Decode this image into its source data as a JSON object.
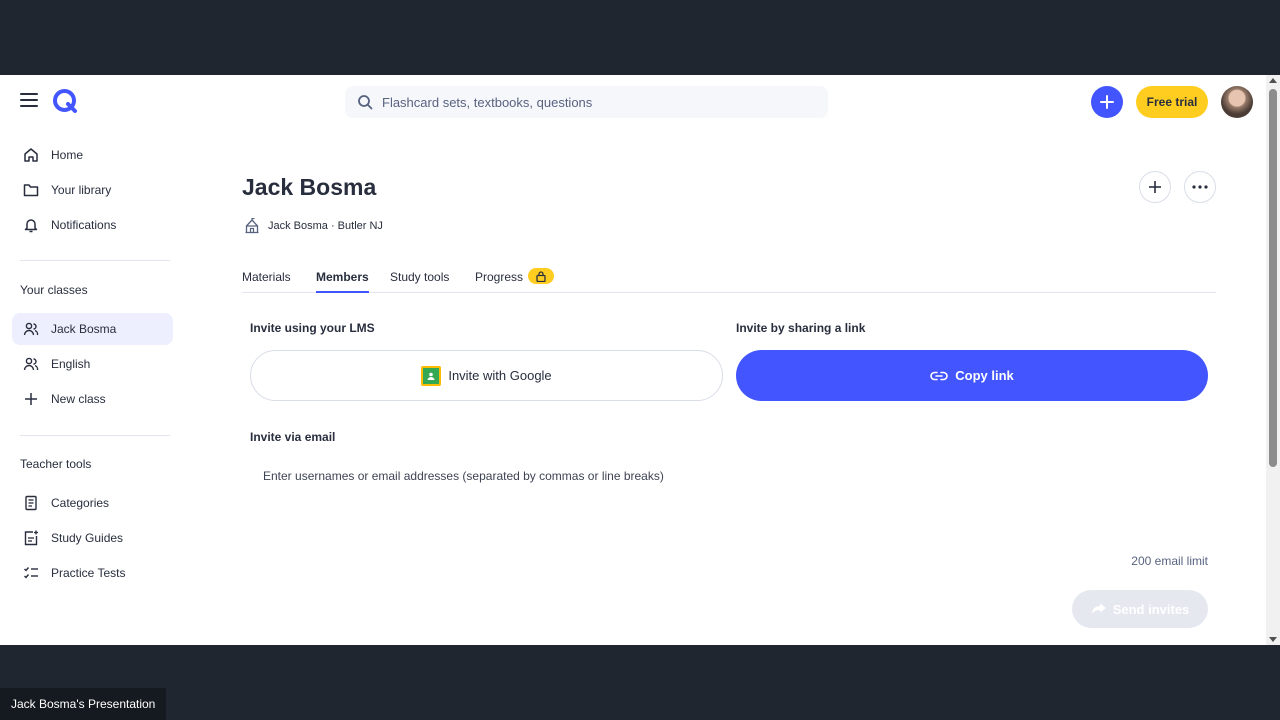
{
  "search": {
    "placeholder": "Flashcard sets, textbooks, questions"
  },
  "header": {
    "free_trial_label": "Free trial"
  },
  "sidebar": {
    "main_items": [
      {
        "label": "Home",
        "icon": "home-icon"
      },
      {
        "label": "Your library",
        "icon": "folder-icon"
      },
      {
        "label": "Notifications",
        "icon": "bell-icon"
      }
    ],
    "classes_heading": "Your classes",
    "classes": [
      {
        "label": "Jack Bosma",
        "icon": "people-icon",
        "active": true
      },
      {
        "label": "English",
        "icon": "people-icon"
      },
      {
        "label": "New class",
        "icon": "plus-icon"
      }
    ],
    "tools_heading": "Teacher tools",
    "tools": [
      {
        "label": "Categories",
        "icon": "categories-icon"
      },
      {
        "label": "Study Guides",
        "icon": "study-guide-icon"
      },
      {
        "label": "Practice Tests",
        "icon": "checklist-icon"
      }
    ]
  },
  "class_page": {
    "title": "Jack Bosma",
    "meta": "Jack Bosma · Butler NJ",
    "tabs": [
      {
        "label": "Materials"
      },
      {
        "label": "Members",
        "active": true
      },
      {
        "label": "Study tools"
      },
      {
        "label": "Progress",
        "locked": true
      }
    ]
  },
  "invite": {
    "lms_heading": "Invite using your LMS",
    "google_label": "Invite with Google",
    "link_heading": "Invite by sharing a link",
    "copy_link_label": "Copy link",
    "email_heading": "Invite via email",
    "email_placeholder": "Enter usernames or email addresses (separated by commas or line breaks)",
    "email_limit": "200 email limit",
    "send_label": "Send invites"
  },
  "presentation": {
    "label": "Jack Bosma's Presentation"
  },
  "colors": {
    "accent": "#4255ff",
    "trial": "#ffcd1f",
    "frame": "#1f2630"
  }
}
